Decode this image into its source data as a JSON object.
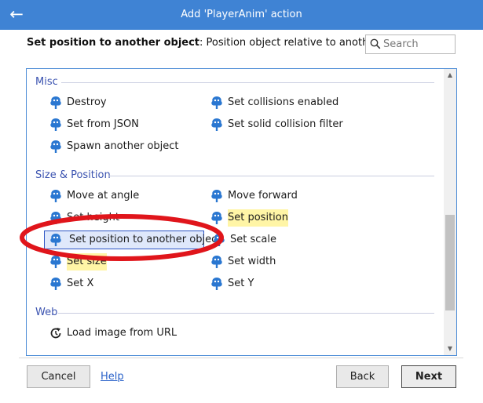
{
  "window": {
    "title": "Add 'PlayerAnim' action",
    "back_icon": "arrow-left-icon"
  },
  "header": {
    "description_bold": "Set position to another object",
    "description_rest": ": Position object relative to another object.",
    "search_placeholder": "Search"
  },
  "colors": {
    "titlebar": "#3f83d4",
    "category": "#3b53b0",
    "highlight": "#fff5a6",
    "selection": "#dfe8fb",
    "annotation_circle": "#e0151b"
  },
  "categories": [
    {
      "name": "Misc",
      "items": [
        {
          "label": "Destroy",
          "icon": "tree-icon"
        },
        {
          "label": "Set collisions enabled",
          "icon": "tree-icon"
        },
        {
          "label": "Set from JSON",
          "icon": "tree-icon"
        },
        {
          "label": "Set solid collision filter",
          "icon": "tree-icon"
        },
        {
          "label": "Spawn another object",
          "icon": "tree-icon"
        }
      ]
    },
    {
      "name": "Size & Position",
      "items": [
        {
          "label": "Move at angle",
          "icon": "tree-icon"
        },
        {
          "label": "Move forward",
          "icon": "tree-icon"
        },
        {
          "label": "Set height",
          "icon": "tree-icon"
        },
        {
          "label": "Set position",
          "icon": "tree-icon",
          "highlighted": true
        },
        {
          "label": "Set position to another object",
          "icon": "tree-icon",
          "selected": true
        },
        {
          "label": "Set scale",
          "icon": "tree-icon"
        },
        {
          "label": "Set size",
          "icon": "tree-icon",
          "highlighted": true
        },
        {
          "label": "Set width",
          "icon": "tree-icon"
        },
        {
          "label": "Set X",
          "icon": "tree-icon"
        },
        {
          "label": "Set Y",
          "icon": "tree-icon"
        }
      ]
    },
    {
      "name": "Web",
      "items": [
        {
          "label": "Load image from URL",
          "icon": "reload-icon"
        }
      ]
    }
  ],
  "footer": {
    "cancel": "Cancel",
    "help": "Help",
    "back": "Back",
    "next": "Next"
  }
}
